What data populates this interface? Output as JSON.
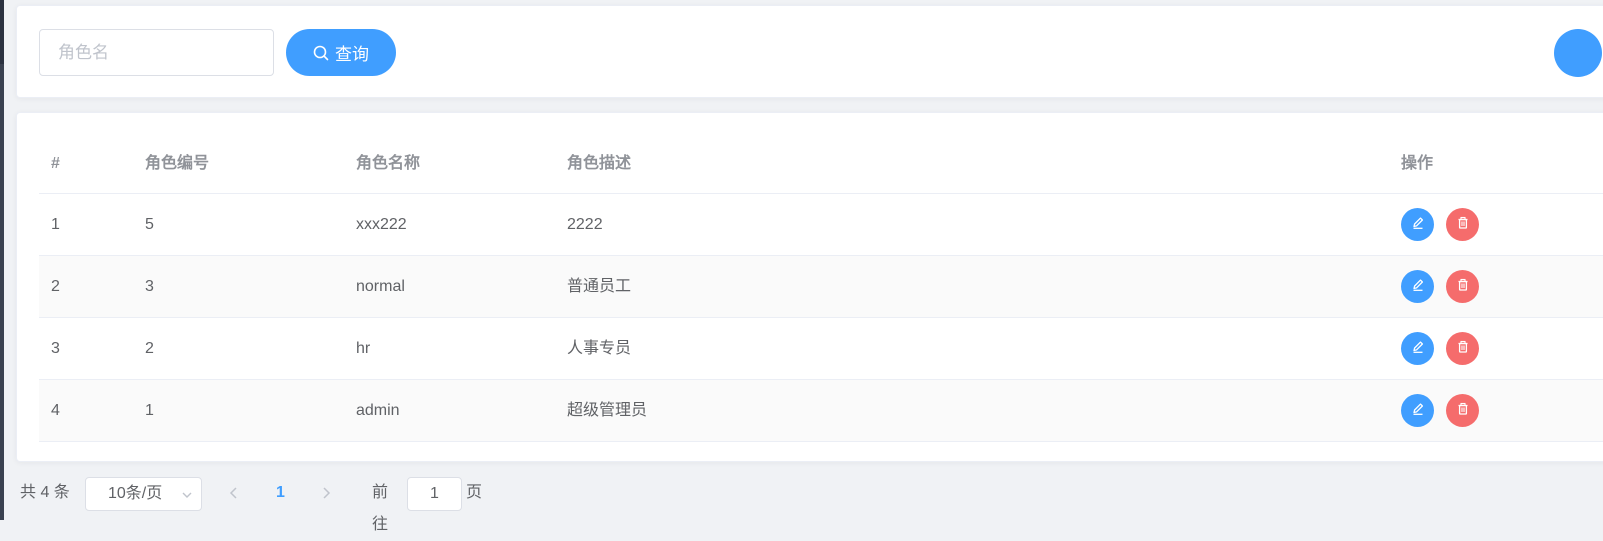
{
  "search": {
    "placeholder": "角色名",
    "value": "",
    "button_label": "查询",
    "button_icon": "search-icon"
  },
  "colors": {
    "primary": "#409eff",
    "danger": "#f56c6c",
    "header_text": "#909399",
    "body_text": "#606266"
  },
  "table": {
    "columns": [
      "#",
      "角色编号",
      "角色名称",
      "角色描述",
      "操作"
    ],
    "rows": [
      {
        "index": "1",
        "id": "5",
        "name": "xxx222",
        "description": "2222"
      },
      {
        "index": "2",
        "id": "3",
        "name": "normal",
        "description": "普通员工"
      },
      {
        "index": "3",
        "id": "2",
        "name": "hr",
        "description": "人事专员"
      },
      {
        "index": "4",
        "id": "1",
        "name": "admin",
        "description": "超级管理员"
      }
    ],
    "row_actions": [
      "edit-icon",
      "delete-icon"
    ]
  },
  "pagination": {
    "total_text": "共 4 条",
    "page_size_label": "10条/页",
    "current_page": "1",
    "goto_prefix": "前往",
    "goto_value": "1",
    "goto_suffix": "页"
  }
}
